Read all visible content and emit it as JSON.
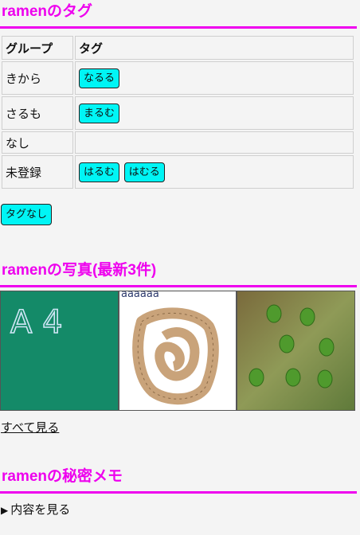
{
  "tags_section": {
    "title": "ramenのタグ",
    "header_group": "グループ",
    "header_tag": "タグ",
    "rows": [
      {
        "group": "きから",
        "tags": [
          "なるる"
        ]
      },
      {
        "group": "さるも",
        "tags": [
          "まるむ"
        ]
      },
      {
        "group": "なし",
        "tags": []
      },
      {
        "group": "未登録",
        "tags": [
          "はるむ",
          "はむる"
        ]
      }
    ],
    "no_tag_button": "タグなし"
  },
  "photos_section": {
    "title": "ramenの写真(最新3件)",
    "photo1_text": "A 4",
    "photo2_text": "aaaaaa",
    "see_all": "すべて見る"
  },
  "memo_section": {
    "title": "ramenの秘密メモ",
    "toggle": "内容を見る"
  }
}
